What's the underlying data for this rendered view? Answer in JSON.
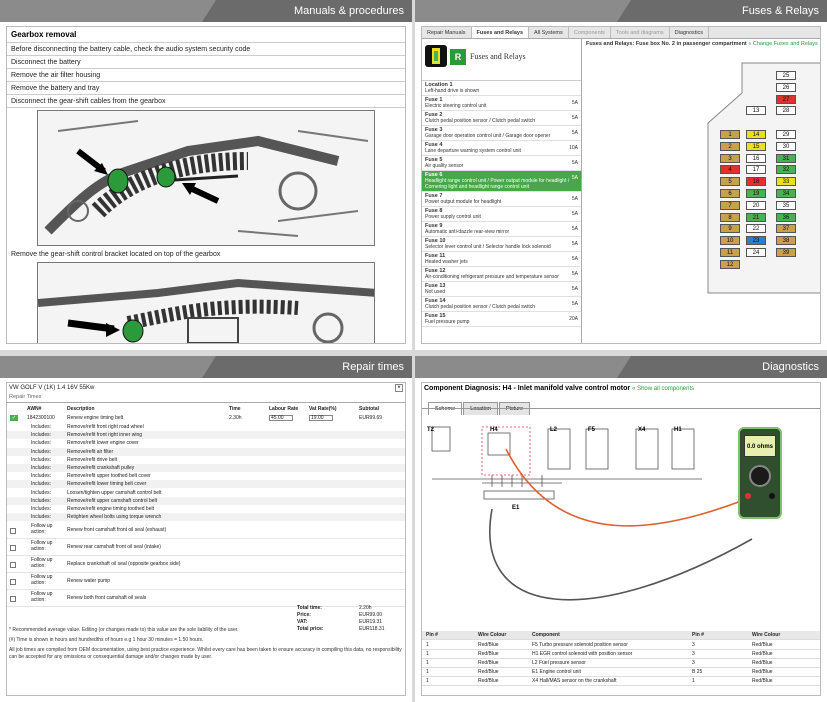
{
  "panels": {
    "manuals": {
      "title": "Manuals & procedures",
      "section": "Gearbox removal",
      "steps": [
        "Before disconnecting the battery cable, check the audio system security code",
        "Disconnect the battery",
        "Remove the air filter housing",
        "Remove the battery and tray",
        "Disconnect the gear-shift cables from the gearbox"
      ],
      "step_after": "Remove the gear-shift control bracket located on top of the gearbox"
    },
    "fuses": {
      "title": "Fuses & Relays",
      "tabs": [
        "Repair Manuals",
        "Fuses and Relays",
        "All Systems",
        "Components",
        "Tools and diagrams",
        "Diagnostics"
      ],
      "logo_text": "Fuses and Relays",
      "header_text": "Fuses and Relays: Fuse box No. 2 in passenger compartment",
      "header_link": "« Change Fuses and Relays",
      "list": [
        {
          "name": "Location 1",
          "desc": "Left-hand drive is shown",
          "amp": ""
        },
        {
          "name": "Fuse 1",
          "desc": "Electric steering control unit",
          "amp": "5A"
        },
        {
          "name": "Fuse 2",
          "desc": "Clutch pedal position sensor / Clutch pedal switch",
          "amp": "5A"
        },
        {
          "name": "Fuse 3",
          "desc": "Garage door operation control unit / Garage door opener",
          "amp": "5A"
        },
        {
          "name": "Fuse 4",
          "desc": "Lane departure warning system control unit",
          "amp": "10A"
        },
        {
          "name": "Fuse 5",
          "desc": "Air quality sensor",
          "amp": "5A"
        },
        {
          "name": "Fuse 6",
          "desc": "Headlight range control unit / Power output module for headlight / Cornering light and headlight range control unit",
          "amp": "5A",
          "hl": true
        },
        {
          "name": "Fuse 7",
          "desc": "Power output module for headlight",
          "amp": "5A"
        },
        {
          "name": "Fuse 8",
          "desc": "Power supply control unit",
          "amp": "5A"
        },
        {
          "name": "Fuse 9",
          "desc": "Automatic anti-dazzle rear-view mirror",
          "amp": "5A"
        },
        {
          "name": "Fuse 10",
          "desc": "Selector lever control unit / Selector handle lock solenoid",
          "amp": "5A"
        },
        {
          "name": "Fuse 11",
          "desc": "Heated washer jets",
          "amp": "5A"
        },
        {
          "name": "Fuse 12",
          "desc": "Air-conditioning refrigerant pressure and temperature sensor",
          "amp": "5A"
        },
        {
          "name": "Fuse 13",
          "desc": "Not used",
          "amp": "5A"
        },
        {
          "name": "Fuse 14",
          "desc": "Clutch pedal position sensor / Clutch pedal switch",
          "amp": "5A"
        },
        {
          "name": "Fuse 15",
          "desc": "Fuel pressure pump",
          "amp": "20A"
        }
      ],
      "box": [
        {
          "n": "25",
          "c": "#ffffff"
        },
        {
          "n": "26",
          "c": "#ffffff"
        },
        {
          "n": "27",
          "c": "#e03030"
        },
        {
          "n": "13",
          "c": "#ffffff"
        },
        {
          "n": "28",
          "c": "#ffffff"
        },
        {
          "n": "1",
          "c": "#c9a050"
        },
        {
          "n": "14",
          "c": "#e8e020"
        },
        {
          "n": "29",
          "c": "#ffffff"
        },
        {
          "n": "2",
          "c": "#c9a050"
        },
        {
          "n": "15",
          "c": "#e8e020"
        },
        {
          "n": "30",
          "c": "#ffffff"
        },
        {
          "n": "3",
          "c": "#c9a050"
        },
        {
          "n": "16",
          "c": "#ffffff"
        },
        {
          "n": "31",
          "c": "#4caf50"
        },
        {
          "n": "4",
          "c": "#e03030"
        },
        {
          "n": "17",
          "c": "#ffffff"
        },
        {
          "n": "32",
          "c": "#4caf50"
        },
        {
          "n": "5",
          "c": "#c9a050"
        },
        {
          "n": "18",
          "c": "#e03030"
        },
        {
          "n": "33",
          "c": "#e8e020"
        },
        {
          "n": "6",
          "c": "#c9a050"
        },
        {
          "n": "19",
          "c": "#4caf50"
        },
        {
          "n": "34",
          "c": "#4caf50"
        },
        {
          "n": "7",
          "c": "#c9a050"
        },
        {
          "n": "20",
          "c": "#ffffff"
        },
        {
          "n": "35",
          "c": "#ffffff"
        },
        {
          "n": "8",
          "c": "#c9a050"
        },
        {
          "n": "21",
          "c": "#4caf50"
        },
        {
          "n": "36",
          "c": "#4caf50"
        },
        {
          "n": "9",
          "c": "#c9a050"
        },
        {
          "n": "22",
          "c": "#ffffff"
        },
        {
          "n": "37",
          "c": "#c9a050"
        },
        {
          "n": "10",
          "c": "#c9a050"
        },
        {
          "n": "23",
          "c": "#2a7fd0"
        },
        {
          "n": "38",
          "c": "#c9a050"
        },
        {
          "n": "11",
          "c": "#c9a050"
        },
        {
          "n": "24",
          "c": "#ffffff"
        },
        {
          "n": "39",
          "c": "#c9a050"
        },
        {
          "n": "12",
          "c": "#c9a050"
        }
      ]
    },
    "repair": {
      "title": "Repair times",
      "vehicle": "VW GOLF V (1K) 1.4 16V 55Kw",
      "sub": "Repair Times",
      "cols": [
        "AWN#",
        "Description",
        "Time",
        "Labour Rate",
        "Vat Rate(%)",
        "Subtotal"
      ],
      "main": {
        "num": "1842300100",
        "desc": "Renew engine timing belt",
        "time": "2.30h",
        "rate": "45.00",
        "vat": "19.00",
        "sub": "EUR99.69"
      },
      "includes_label": "Includes:",
      "includes": [
        "Remove/refit front right road wheel",
        "Remove/refit front right inner wing",
        "Remove/refit lower engine cover",
        "Remove/refit air filter",
        "Remove/refit drive belt",
        "Remove/refit crankshaft pulley",
        "Remove/refit upper toothed belt cover",
        "Remove/refit lower timing belt cover",
        "Loosen/tighten upper camshaft control belt",
        "Remove/refit upper camshaft control belt",
        "Remove/refit engine timing toothed belt",
        "Retighten wheel bolts using torque wrench"
      ],
      "followup_label": "Follow up action:",
      "followups": [
        "Renew front camshaft front oil seal (exhaust)",
        "Renew rear camshaft front oil seal (intake)",
        "Replace crankshaft oil seal (opposite gearbox side)",
        "Renew water pump",
        "Renew both front camshaft oil seals"
      ],
      "totals": [
        {
          "label": "Total time:",
          "value": "2.20h"
        },
        {
          "label": "Price:",
          "value": "EUR99.00"
        },
        {
          "label": "VAT:",
          "value": "EUR19.31"
        },
        {
          "label": "Total price:",
          "value": "EUR118.31"
        }
      ],
      "notes": [
        "* Recommended average value. Editing (or changes made to) this value are the sole liability of the user.",
        "(#) Time is shown in hours and hundredths of hours e.g 1 hour 30 minutes = 1.50 hours.",
        "All job times are compiled from OEM documentation, using best practice experience. Whilst every care has been taken to ensure accuracy in compiling this data, no responsibility can be accepted for any omissions or consequential damage and/or changes made by user."
      ]
    },
    "diag": {
      "title": "Diagnostics",
      "heading": "Component Diagnosis: H4 - Inlet manifold valve control motor",
      "link": "« Show all components",
      "tabs": [
        "Scheme",
        "Location",
        "Picture"
      ],
      "labels": [
        "T2",
        "H4",
        "L2",
        "F5",
        "X4",
        "H1",
        "E1"
      ],
      "meter_reading": "0.0 ohms",
      "cols": [
        "Pin #",
        "Wire Colour",
        "Component",
        "Pin #",
        "Wire Colour"
      ],
      "rows": [
        {
          "a": "1",
          "b": "Red/Blue",
          "c": "F5 Turbo pressure solenoid position sensor",
          "d": "3",
          "e": "Red/Blue"
        },
        {
          "a": "1",
          "b": "Red/Blue",
          "c": "H1 EGR control solenoid with position sensor",
          "d": "3",
          "e": "Red/Blue"
        },
        {
          "a": "1",
          "b": "Red/Blue",
          "c": "L2 Fuel pressure sensor",
          "d": "3",
          "e": "Red/Blue"
        },
        {
          "a": "1",
          "b": "Red/Blue",
          "c": "E1 Engine control unit",
          "d": "B 25",
          "e": "Red/Blue"
        },
        {
          "a": "1",
          "b": "Red/Blue",
          "c": "X4 Hall/MAS sensor on the crankshaft",
          "d": "1",
          "e": "Red/Blue"
        }
      ]
    }
  }
}
